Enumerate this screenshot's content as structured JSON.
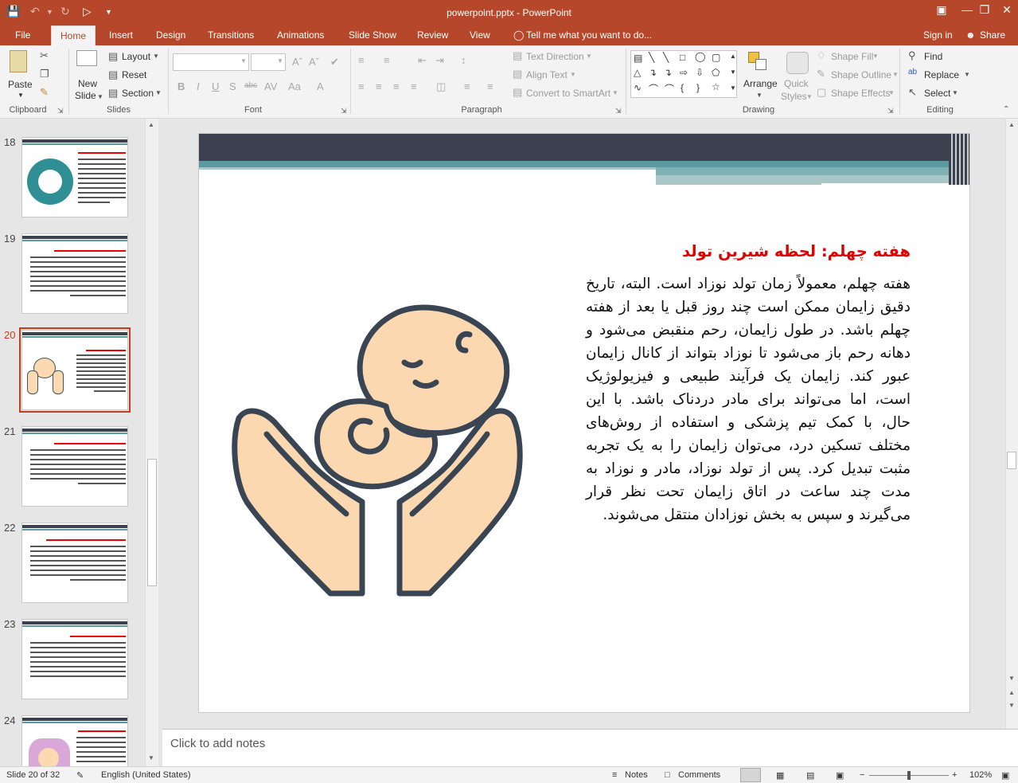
{
  "window": {
    "title": "powerpoint.pptx - PowerPoint"
  },
  "tabs": [
    "File",
    "Home",
    "Insert",
    "Design",
    "Transitions",
    "Animations",
    "Slide Show",
    "Review",
    "View"
  ],
  "tell_me": "Tell me what you want to do...",
  "account": {
    "signin": "Sign in",
    "share": "Share"
  },
  "ribbon": {
    "paste": "Paste",
    "new_slide": "New",
    "new_slide2": "Slide",
    "layout": "Layout",
    "reset": "Reset",
    "section": "Section",
    "text_direction": "Text Direction",
    "align_text": "Align Text",
    "convert_smartart": "Convert to SmartArt",
    "arrange": "Arrange",
    "quick": "Quick",
    "styles": "Styles",
    "shape_fill": "Shape Fill",
    "shape_outline": "Shape Outline",
    "shape_effects": "Shape Effects",
    "find": "Find",
    "replace": "Replace",
    "select": "Select",
    "groups": {
      "clipboard": "Clipboard",
      "slides": "Slides",
      "font": "Font",
      "paragraph": "Paragraph",
      "drawing": "Drawing",
      "editing": "Editing"
    }
  },
  "thumbnails": [
    {
      "num": "18"
    },
    {
      "num": "19"
    },
    {
      "num": "20"
    },
    {
      "num": "21"
    },
    {
      "num": "22"
    },
    {
      "num": "23"
    },
    {
      "num": "24"
    }
  ],
  "slide": {
    "heading": "هفته چهلم: لحظه شیرین تولد",
    "body": "هفته چهلم، معمولاً زمان تولد نوزاد است. البته، تاریخ دقیق زایمان ممکن است چند روز قبل یا بعد از هفته چهلم باشد. در طول زایمان، رحم منقبض می‌شود و دهانه رحم باز می‌شود تا نوزاد بتواند از کانال زایمان عبور کند. زایمان یک فرآیند طبیعی و فیزیولوژیک است، اما می‌تواند برای مادر دردناک باشد. با این حال، با کمک تیم پزشکی و استفاده از روش‌های مختلف تسکین درد، می‌توان زایمان را به یک تجربه مثبت تبدیل کرد. پس از تولد نوزاد، مادر و نوزاد به مدت چند ساعت در اتاق زایمان تحت نظر قرار می‌گیرند و سپس به بخش نوزادان منتقل می‌شوند."
  },
  "notes": {
    "placeholder": "Click to add notes"
  },
  "status": {
    "slide": "Slide 20 of 32",
    "lang": "English (United States)",
    "notes": "Notes",
    "comments": "Comments",
    "zoom": "102%"
  },
  "colors": {
    "accent": "#b7472a",
    "slide_header": "#3d404f",
    "teal": "#5b9aa0",
    "heading_red": "#e00000"
  }
}
